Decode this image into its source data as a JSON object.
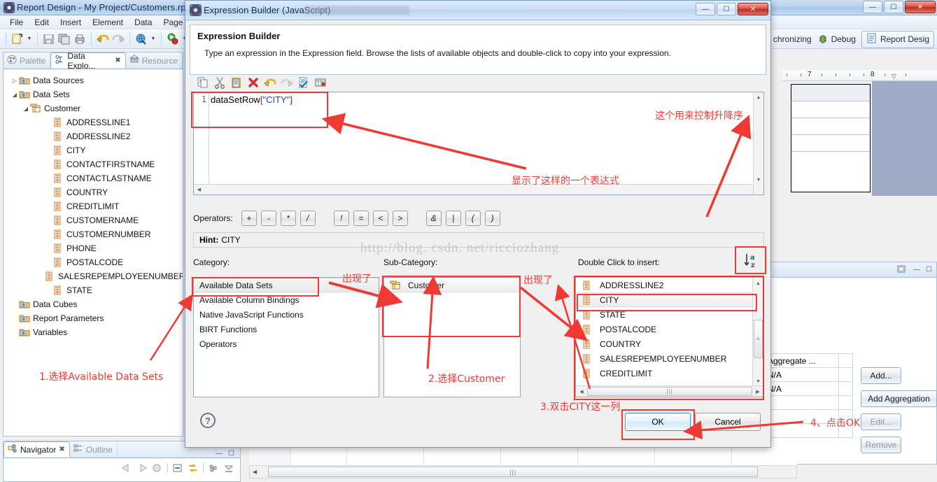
{
  "main_window": {
    "title": "Report Design - My Project/Customers.rptdesign - Eclipse",
    "icon": "eclipse-icon",
    "window_buttons": [
      "minimize",
      "maximize",
      "close"
    ],
    "menu": [
      "File",
      "Edit",
      "Insert",
      "Element",
      "Data",
      "Page"
    ],
    "toolbar_icons": [
      "new-report-icon",
      "dropdown-arrow",
      "save-icon",
      "save-all-icon",
      "print-icon",
      "undo-icon",
      "redo-icon",
      "preview-web-icon",
      "dropdown-arrow",
      "run-icon",
      "dropdown-arrow"
    ],
    "perspective_bar": {
      "synchronizing_label": "chronizing",
      "debug_label": "Debug",
      "debug_icon": "bug-icon",
      "report_design_label": "Report Desig",
      "report_design_icon": "report-design-icon"
    }
  },
  "left_view": {
    "tabs": [
      {
        "label": "Palette",
        "icon": "palette-icon",
        "active": false
      },
      {
        "label": "Data Explo...",
        "icon": "data-explorer-icon",
        "active": true,
        "close": "✖"
      },
      {
        "label": "Resource",
        "icon": "resource-icon",
        "active": false
      }
    ],
    "tree": [
      {
        "label": "Data Sources",
        "icon": "folder-icon",
        "indent": 0,
        "twisty": "▷"
      },
      {
        "label": "Data Sets",
        "icon": "folder-icon",
        "indent": 0,
        "twisty": "◢"
      },
      {
        "label": "Customer",
        "icon": "dataset-icon",
        "indent": 1,
        "twisty": "◢"
      },
      {
        "label": "ADDRESSLINE1",
        "icon": "field-icon",
        "indent": 3,
        "twisty": ""
      },
      {
        "label": "ADDRESSLINE2",
        "icon": "field-icon",
        "indent": 3,
        "twisty": ""
      },
      {
        "label": "CITY",
        "icon": "field-icon",
        "indent": 3,
        "twisty": ""
      },
      {
        "label": "CONTACTFIRSTNAME",
        "icon": "field-icon",
        "indent": 3,
        "twisty": ""
      },
      {
        "label": "CONTACTLASTNAME",
        "icon": "field-icon",
        "indent": 3,
        "twisty": ""
      },
      {
        "label": "COUNTRY",
        "icon": "field-icon",
        "indent": 3,
        "twisty": ""
      },
      {
        "label": "CREDITLIMIT",
        "icon": "field-icon",
        "indent": 3,
        "twisty": ""
      },
      {
        "label": "CUSTOMERNAME",
        "icon": "field-icon",
        "indent": 3,
        "twisty": ""
      },
      {
        "label": "CUSTOMERNUMBER",
        "icon": "field-icon",
        "indent": 3,
        "twisty": ""
      },
      {
        "label": "PHONE",
        "icon": "field-icon",
        "indent": 3,
        "twisty": ""
      },
      {
        "label": "POSTALCODE",
        "icon": "field-icon",
        "indent": 3,
        "twisty": ""
      },
      {
        "label": "SALESREPEMPLOYEENUMBER",
        "icon": "field-icon",
        "indent": 3,
        "twisty": ""
      },
      {
        "label": "STATE",
        "icon": "field-icon",
        "indent": 3,
        "twisty": ""
      },
      {
        "label": "Data Cubes",
        "icon": "folder-icon",
        "indent": 0,
        "twisty": ""
      },
      {
        "label": "Report Parameters",
        "icon": "folder-icon",
        "indent": 0,
        "twisty": ""
      },
      {
        "label": "Variables",
        "icon": "folder-icon",
        "indent": 0,
        "twisty": ""
      }
    ]
  },
  "navigator_view": {
    "tabs": [
      {
        "label": "Navigator",
        "icon": "navigator-icon",
        "active": true,
        "close": "✖"
      },
      {
        "label": "Outline",
        "icon": "outline-icon",
        "active": false
      }
    ],
    "toolbar_icons": [
      "back-arrow-icon",
      "forward-arrow-icon",
      "home-icon",
      "collapse-all-icon",
      "link-editor-icon",
      "view-menu-icon",
      "minimize-icon",
      "maximize-icon"
    ]
  },
  "editor": {
    "ruler_numbers": [
      "7",
      "8"
    ]
  },
  "properties_panel": {
    "table_header": "Aggregate ...",
    "rows": [
      "N/A",
      "N/A"
    ],
    "buttons": [
      {
        "label": "Add...",
        "enabled": true
      },
      {
        "label": "Add Aggregation",
        "enabled": true
      },
      {
        "label": "Edit...",
        "enabled": false
      },
      {
        "label": "Remove",
        "enabled": false
      }
    ],
    "toolbar_icons": [
      "restore-icon",
      "minimize-icon",
      "maximize-icon"
    ]
  },
  "dialog": {
    "title": "Expression Builder (JavaScript)",
    "icon": "expression-builder-icon",
    "window_buttons": [
      "minimize",
      "maximize",
      "close"
    ],
    "heading": "Expression Builder",
    "description": "Type an expression in the Expression field. Browse the lists of available objects and double-click to copy into your expression.",
    "toolbar_icons": [
      "copy-icon",
      "cut-icon",
      "paste-icon",
      "delete-icon",
      "undo-icon",
      "redo-icon",
      "validate-icon",
      "insert-field-icon"
    ],
    "expression": {
      "line_number": "1",
      "prefix": "dataSetRow",
      "open_bracket": "[",
      "string": "\"CITY\"",
      "close_bracket": "]"
    },
    "operators_label": "Operators:",
    "operators_group1": [
      "+",
      "-",
      "*",
      "/"
    ],
    "operators_group2": [
      "!",
      "=",
      "<",
      ">"
    ],
    "operators_group3": [
      "&",
      "|",
      "(",
      ")"
    ],
    "hint_label": "Hint:",
    "hint_value": "CITY",
    "category_label": "Category:",
    "subcategory_label": "Sub-Category:",
    "insert_label": "Double Click to insert:",
    "sort_icon": "sort-az-icon",
    "category_items": [
      {
        "label": "Available Data Sets",
        "selected": true
      },
      {
        "label": "Available Column Bindings",
        "selected": false
      },
      {
        "label": "Native JavaScript Functions",
        "selected": false
      },
      {
        "label": "BIRT Functions",
        "selected": false
      },
      {
        "label": "Operators",
        "selected": false
      }
    ],
    "subcategory_items": [
      {
        "label": "Customer",
        "icon": "dataset-icon",
        "selected": true
      }
    ],
    "insert_items": [
      {
        "label": "ADDRESSLINE2",
        "icon": "field-icon",
        "selected": false
      },
      {
        "label": "CITY",
        "icon": "field-icon",
        "selected": true
      },
      {
        "label": "STATE",
        "icon": "field-icon",
        "selected": false
      },
      {
        "label": "POSTALCODE",
        "icon": "field-icon",
        "selected": false
      },
      {
        "label": "COUNTRY",
        "icon": "field-icon",
        "selected": false
      },
      {
        "label": "SALESREPEMPLOYEENUMBER",
        "icon": "field-icon",
        "selected": false
      },
      {
        "label": "CREDITLIMIT",
        "icon": "field-icon",
        "selected": false
      }
    ],
    "help_icon": "help-icon",
    "ok_label": "OK",
    "cancel_label": "Cancel"
  },
  "annotations": {
    "color": "#ef3a34",
    "step1": "1.选择Available Data Sets",
    "step2": "2.选择Customer",
    "step3": "3.双击CITY这一列",
    "step4": "4、点击OK",
    "appeared_1": "出现了",
    "appeared_2": "出现了",
    "expression_note": "显示了这样的一个表达式",
    "sort_note": "这个用来控制升降序"
  },
  "watermark": "http://blog. csdn. net/ricciozhang"
}
